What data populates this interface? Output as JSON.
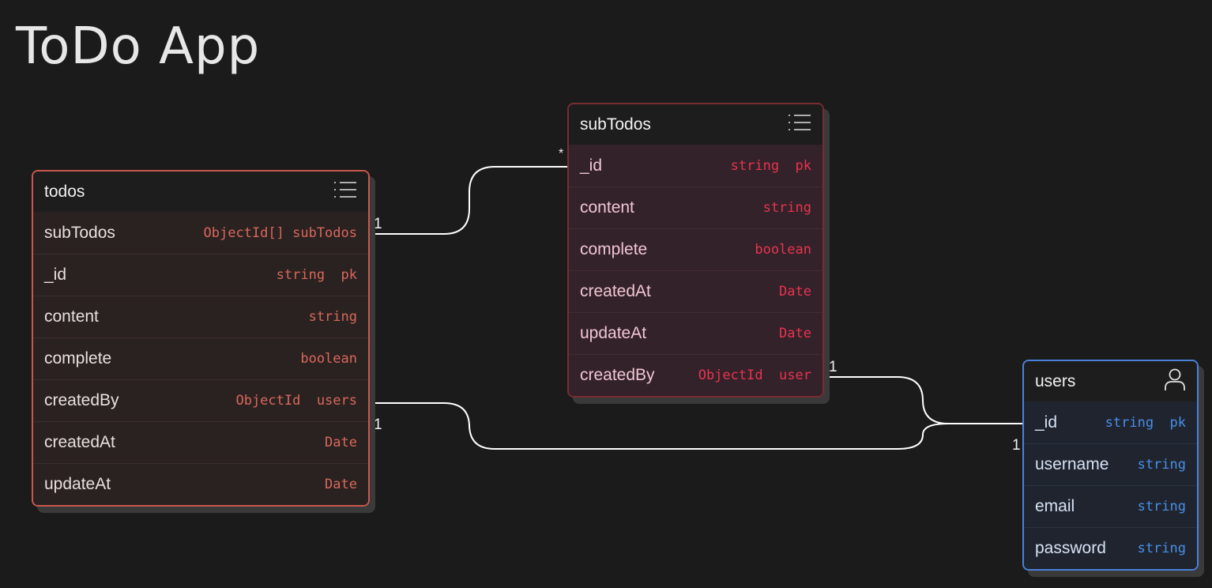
{
  "title": "ToDo App",
  "tables": {
    "todos": {
      "name": "todos",
      "icon": "list-icon",
      "fields": [
        {
          "name": "subTodos",
          "type": "ObjectId[] subTodos"
        },
        {
          "name": "_id",
          "type": "string  pk"
        },
        {
          "name": "content",
          "type": "string"
        },
        {
          "name": "complete",
          "type": "boolean"
        },
        {
          "name": "createdBy",
          "type": "ObjectId  users"
        },
        {
          "name": "createdAt",
          "type": "Date"
        },
        {
          "name": "updateAt",
          "type": "Date"
        }
      ]
    },
    "subTodos": {
      "name": "subTodos",
      "icon": "list-icon",
      "fields": [
        {
          "name": "_id",
          "type": "string  pk"
        },
        {
          "name": "content",
          "type": "string"
        },
        {
          "name": "complete",
          "type": "boolean"
        },
        {
          "name": "createdAt",
          "type": "Date"
        },
        {
          "name": "updateAt",
          "type": "Date"
        },
        {
          "name": "createdBy",
          "type": "ObjectId  user"
        }
      ]
    },
    "users": {
      "name": "users",
      "icon": "user-icon",
      "fields": [
        {
          "name": "_id",
          "type": "string  pk"
        },
        {
          "name": "username",
          "type": "string"
        },
        {
          "name": "email",
          "type": "string"
        },
        {
          "name": "password",
          "type": "string"
        }
      ]
    }
  },
  "relations": [
    {
      "from": "todos.subTodos",
      "to": "subTodos._id",
      "from_label": "1",
      "to_label": "*"
    },
    {
      "from": "todos.createdBy",
      "to": "users._id",
      "from_label": "1",
      "to_label": "1"
    },
    {
      "from": "subTodos.createdBy",
      "to": "users._id",
      "from_label": "1",
      "to_label": "1"
    }
  ],
  "colors": {
    "background": "#1b1b1b",
    "todos_accent": "#c8584e",
    "subTodos_accent": "#e8334f",
    "users_accent": "#4a82d9",
    "connector": "#ffffff"
  }
}
